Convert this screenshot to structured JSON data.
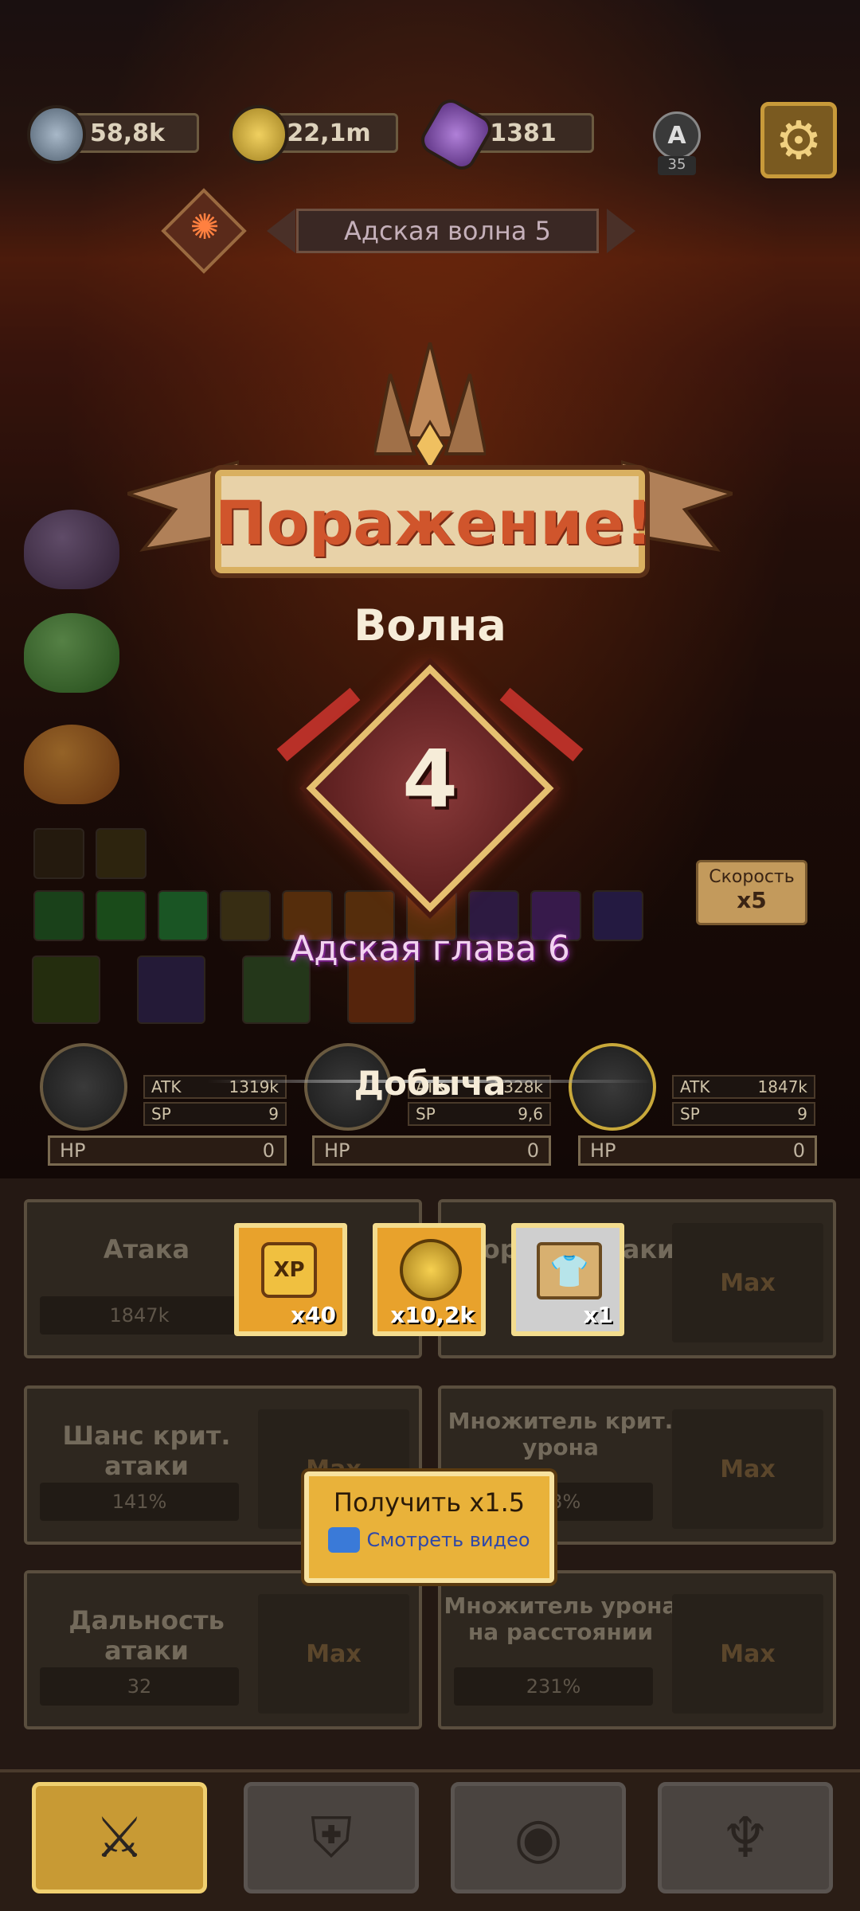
{
  "currency": {
    "blue": "58,8k",
    "gold": "22,1m",
    "gems": "1381"
  },
  "rank": {
    "letter": "A",
    "level": "35"
  },
  "wave_banner": {
    "title": "Адская волна 5"
  },
  "popup": {
    "title": "Поражение!",
    "wave_label": "Волна",
    "wave_number": "4",
    "chapter": "Адская глава 6",
    "loot_label": "Добыча",
    "loot": [
      {
        "name": "XP",
        "qty": "x40"
      },
      {
        "name": "gold",
        "qty": "x10,2k"
      },
      {
        "name": "outfit",
        "qty": "x1"
      }
    ],
    "reward": {
      "get_label": "Получить x1.5",
      "video_label": "Смотреть видео"
    }
  },
  "speed": {
    "label": "Скорость",
    "value": "x5"
  },
  "heroes": [
    {
      "atk_label": "ATK",
      "atk": "1319k",
      "sp_label": "SP",
      "sp": "9",
      "hp_label": "HP",
      "hp": "0"
    },
    {
      "atk_label": "ATK",
      "atk": "1328k",
      "sp_label": "SP",
      "sp": "9,6",
      "hp_label": "HP",
      "hp": "0"
    },
    {
      "atk_label": "ATK",
      "atk": "1847k",
      "sp_label": "SP",
      "sp": "9",
      "hp_label": "HP",
      "hp": "0"
    }
  ],
  "upgrades": [
    {
      "title": "Атака",
      "value": "1847k",
      "button": ""
    },
    {
      "title": "Скорость атаки",
      "value": "",
      "button": "Max"
    },
    {
      "title": "Шанс крит. атаки",
      "value": "141%",
      "button": "Max"
    },
    {
      "title": "Множитель крит. урона",
      "value": "243%",
      "button": "Max"
    },
    {
      "title": "Дальность атаки",
      "value": "32",
      "button": "Max"
    },
    {
      "title": "Множитель урона на расстоянии",
      "value": "231%",
      "button": "Max"
    }
  ],
  "nav": [
    {
      "name": "battle-tab-icon",
      "glyph": "⚔"
    },
    {
      "name": "shield-tab-icon",
      "glyph": "⛨"
    },
    {
      "name": "slime-tab-icon",
      "glyph": "◉"
    },
    {
      "name": "sword-wings-tab-icon",
      "glyph": "♆"
    }
  ]
}
